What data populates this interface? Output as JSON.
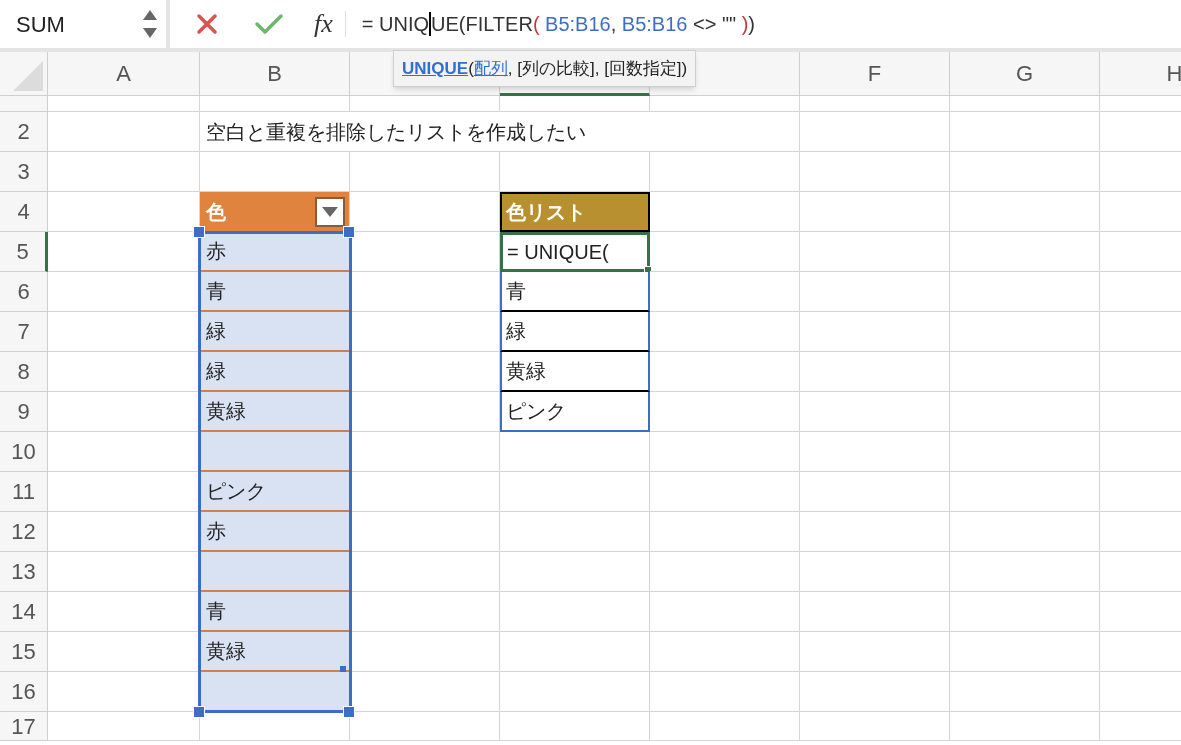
{
  "name_box": {
    "value": "SUM"
  },
  "formula_bar": {
    "function_label": "fx",
    "tokens": [
      {
        "kind": "text",
        "text": "= UNIQ"
      },
      {
        "kind": "caret"
      },
      {
        "kind": "text",
        "text": "UE(FILTER"
      },
      {
        "kind": "paren",
        "text": "("
      },
      {
        "kind": "ref",
        "text": " B5:B16"
      },
      {
        "kind": "text",
        "text": ","
      },
      {
        "kind": "ref",
        "text": " B5:B16"
      },
      {
        "kind": "text",
        "text": " <> \"\" "
      },
      {
        "kind": "paren",
        "text": ")"
      },
      {
        "kind": "text",
        "text": ")"
      }
    ]
  },
  "tooltip": {
    "parts": [
      {
        "kind": "function",
        "text": "UNIQUE"
      },
      {
        "kind": "text",
        "text": "("
      },
      {
        "kind": "current_arg",
        "text": "配列"
      },
      {
        "kind": "text",
        "text": ", [列の比較], [回数指定])"
      }
    ]
  },
  "columns": [
    {
      "label": "A",
      "selected": false
    },
    {
      "label": "B",
      "selected": false
    },
    {
      "selected": false
    },
    {
      "selected": true
    },
    {
      "selected": false
    },
    {
      "label": "F",
      "selected": false
    },
    {
      "label": "G",
      "selected": false
    },
    {
      "label": "H",
      "selected": false
    }
  ],
  "rows": [
    {
      "selected": false
    },
    {
      "label": "2",
      "selected": false
    },
    {
      "label": "3",
      "selected": false
    },
    {
      "label": "4",
      "selected": false
    },
    {
      "label": "5",
      "selected": true
    },
    {
      "label": "6",
      "selected": false
    },
    {
      "label": "7",
      "selected": false
    },
    {
      "label": "8",
      "selected": false
    },
    {
      "label": "9",
      "selected": false
    },
    {
      "label": "10",
      "selected": false
    },
    {
      "label": "11",
      "selected": false
    },
    {
      "label": "12",
      "selected": false
    },
    {
      "label": "13",
      "selected": false
    },
    {
      "label": "14",
      "selected": false
    },
    {
      "label": "15",
      "selected": false
    },
    {
      "label": "16",
      "selected": false
    },
    {
      "label": "17",
      "selected": false
    }
  ],
  "note": {
    "text": "空白と重複を排除したリストを作成したい"
  },
  "source_table": {
    "header": "色",
    "selected": true,
    "rows": [
      {
        "value": "赤"
      },
      {
        "value": "青"
      },
      {
        "value": "緑"
      },
      {
        "value": "緑"
      },
      {
        "value": "黄緑"
      },
      {},
      {
        "value": "ピンク"
      },
      {
        "value": "赤"
      },
      {},
      {
        "value": "青"
      },
      {
        "value": "黄緑"
      },
      {}
    ]
  },
  "result_list": {
    "header": "色リスト",
    "rows": [
      {
        "value": "= UNIQUE(",
        "editing": true
      },
      {
        "value": "青",
        "editing": false
      },
      {
        "value": "緑",
        "editing": false
      },
      {
        "value": "黄緑",
        "editing": false
      },
      {
        "value": "ピンク",
        "editing": false
      }
    ]
  }
}
